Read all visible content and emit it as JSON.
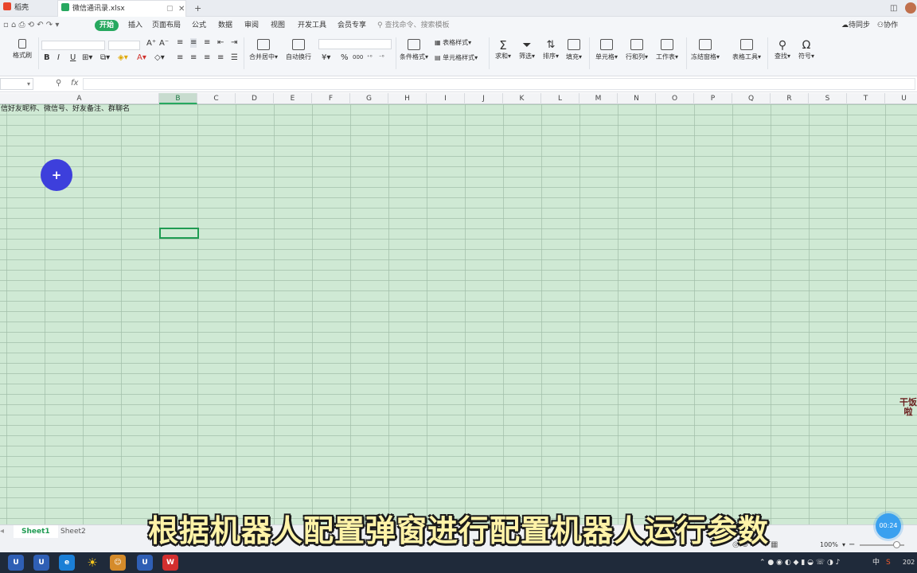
{
  "tabs": {
    "tab1": "稻壳",
    "tab2": "微信通讯录.xlsx",
    "new_tab": "+"
  },
  "menu": {
    "home": "开始",
    "insert": "插入",
    "layout": "页面布局",
    "formula": "公式",
    "data": "数据",
    "review": "审阅",
    "view": "视图",
    "dev": "开发工具",
    "member": "会员专享",
    "search": "查找命令、搜索模板",
    "sync": "待同步",
    "collab": "协作"
  },
  "ribbon": {
    "format_painter": "格式刷",
    "bold": "B",
    "italic": "I",
    "underline": "U",
    "merge": "合并居中",
    "wrap": "自动换行",
    "currency": "¥",
    "percent": "%",
    "thousands": "000",
    "cond_format": "条件格式",
    "table_style": "表格样式",
    "cell_style": "单元格样式",
    "sum": "求和",
    "filter": "筛选",
    "sort": "排序",
    "fill": "填充",
    "cells": "单元格",
    "rowcol": "行和列",
    "worksheet": "工作表",
    "freeze": "冻结窗格",
    "table_tools": "表格工具",
    "find": "查找",
    "symbol": "符号"
  },
  "formula_bar": {
    "fx": "fx",
    "content": ""
  },
  "columns": [
    "A",
    "B",
    "C",
    "D",
    "E",
    "F",
    "G",
    "H",
    "I",
    "J",
    "K",
    "L",
    "M",
    "N",
    "O",
    "P",
    "Q",
    "R",
    "S",
    "T",
    "U"
  ],
  "selected_column": "B",
  "cells": {
    "A1": "信好友昵称、微信号、好友备注、群聊名"
  },
  "sheets": [
    "Sheet1",
    "Sheet2"
  ],
  "status": {
    "zoom": "100%"
  },
  "caption": "根据机器人配置弹窗进行配置机器人运行参数",
  "timer": "00:24",
  "tray": {
    "ime": "中",
    "year": "202"
  },
  "sticker": "干饭啦",
  "colors": {
    "accent": "#27a85f",
    "grid_bg": "#cfe9d4",
    "pointer": "#3d3fdc"
  }
}
